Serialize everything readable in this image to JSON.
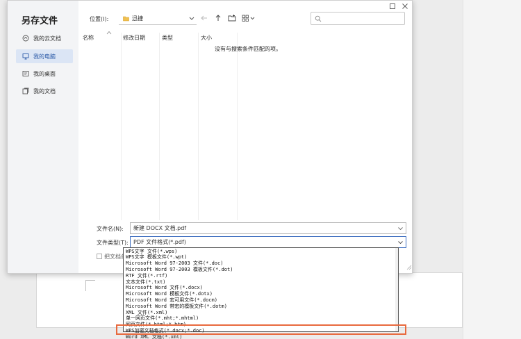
{
  "dialog": {
    "title": "另存文件",
    "sidebar": {
      "items": [
        {
          "label": "我的云文档",
          "icon": "cloud-icon",
          "active": false
        },
        {
          "label": "我的电脑",
          "icon": "computer-icon",
          "active": true
        },
        {
          "label": "我的桌面",
          "icon": "desktop-icon",
          "active": false
        },
        {
          "label": "我的文档",
          "icon": "documents-icon",
          "active": false
        }
      ]
    },
    "toolbar": {
      "location_label": "位置(I):",
      "location_value": "迅捷"
    },
    "columns": [
      "名称",
      "修改日期",
      "类型",
      "大小"
    ],
    "empty_message": "没有与搜索条件匹配的项。",
    "filename_label": "文件名(N):",
    "filename_value": "新建 DOCX 文档.pdf",
    "filetype_label": "文件类型(T):",
    "filetype_value": "PDF 文件格式(*.pdf)",
    "backup_label": "把文档备份"
  },
  "dropdown_options": [
    "WPS文字 文件(*.wps)",
    "WPS文字 模板文件(*.wpt)",
    "Microsoft Word 97-2003 文件(*.doc)",
    "Microsoft Word 97-2003 模板文件(*.dot)",
    "RTF 文件(*.rtf)",
    "文本文件(*.txt)",
    "Microsoft Word 文件(*.docx)",
    "Microsoft Word 模板文件(*.dotx)",
    "Microsoft Word 宏可用文件(*.docm)",
    "Microsoft Word 带宏的模板文件(*.dotm)",
    "XML 文件(*.xml)",
    "单一网页文件(*.mht;*.mhtml)",
    "网页文件(*.html;*.htm)",
    "WPS加密文档格式(*.docx;*.doc)",
    "Word XML 文档(*.xml)",
    "PDF 文件格式(*.pdf)"
  ],
  "selected_option_index": 15,
  "colors": {
    "accent": "#0f6fd8",
    "highlight_frame": "#e8693d",
    "sidebar_active": "#dbe5f5"
  }
}
